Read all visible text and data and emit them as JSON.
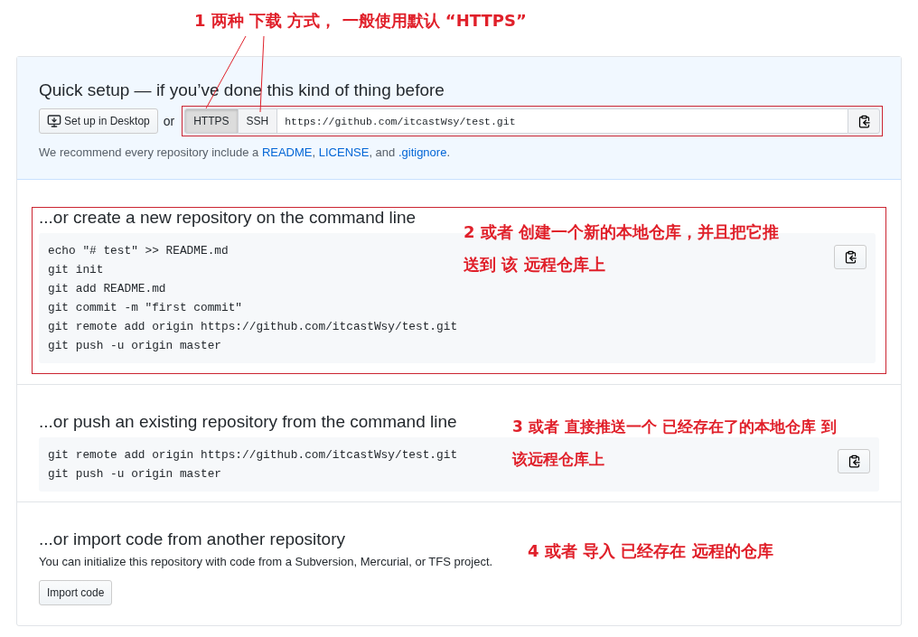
{
  "top_annotation": "1 两种 下载 方式， 一般使用默认 “HTTPS”",
  "quick_setup": {
    "title": "Quick setup — if you’ve done this kind of thing before",
    "desktop_button": "Set up in Desktop",
    "or": "or",
    "protocols": [
      {
        "label": "HTTPS",
        "selected": true
      },
      {
        "label": "SSH",
        "selected": false
      }
    ],
    "url": "https://github.com/itcastWsy/test.git",
    "recommend": [
      {
        "kind": "text",
        "text": "We recommend every repository include a "
      },
      {
        "kind": "link",
        "text": "README"
      },
      {
        "kind": "text",
        "text": ", "
      },
      {
        "kind": "link",
        "text": "LICENSE"
      },
      {
        "kind": "text",
        "text": ", and "
      },
      {
        "kind": "link",
        "text": ".gitignore"
      },
      {
        "kind": "text",
        "text": "."
      }
    ]
  },
  "sections": [
    {
      "kind": "code",
      "framed": true,
      "title": "...or create a new repository on the command line",
      "lines": [
        "echo \"# test\" >> README.md",
        "git init",
        "git add README.md",
        "git commit -m \"first commit\"",
        "git remote add origin https://github.com/itcastWsy/test.git",
        "git push -u origin master"
      ],
      "annotation": "2 或者 创建一个新的本地仓库，并且把它推送到 该 远程仓库上"
    },
    {
      "kind": "code",
      "framed": false,
      "title": "...or push an existing repository from the command line",
      "lines": [
        "git remote add origin https://github.com/itcastWsy/test.git",
        "git push -u origin master"
      ],
      "annotation": "3 或者 直接推送一个 已经存在了的本地仓库 到该远程仓库上"
    },
    {
      "kind": "import",
      "framed": false,
      "title": "...or import code from another repository",
      "text": "You can initialize this repository with code from a Subversion, Mercurial, or TFS project.",
      "button": "Import code",
      "annotation": "4 或者 导入 已经存在 远程的仓库"
    }
  ]
}
